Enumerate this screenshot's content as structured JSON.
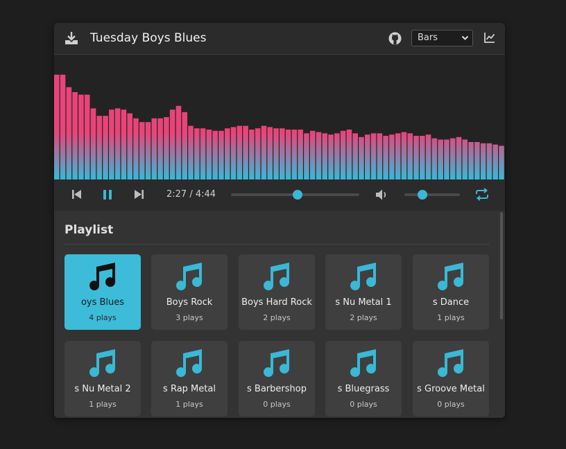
{
  "header": {
    "title": "Tuesday Boys Blues",
    "download_icon": "download-icon",
    "github_icon": "github-icon",
    "visualizer_select": "Bars",
    "chart_icon": "chart-icon"
  },
  "visualizer": {
    "gradient_top": "#e8447a",
    "gradient_bottom": "#3ab8d6",
    "bar_levels": [
      0.84,
      0.84,
      0.74,
      0.7,
      0.68,
      0.68,
      0.57,
      0.51,
      0.51,
      0.56,
      0.57,
      0.56,
      0.53,
      0.49,
      0.46,
      0.46,
      0.49,
      0.49,
      0.5,
      0.56,
      0.59,
      0.54,
      0.43,
      0.41,
      0.41,
      0.4,
      0.39,
      0.39,
      0.41,
      0.42,
      0.43,
      0.43,
      0.4,
      0.41,
      0.43,
      0.42,
      0.41,
      0.41,
      0.4,
      0.4,
      0.4,
      0.37,
      0.39,
      0.38,
      0.37,
      0.36,
      0.37,
      0.39,
      0.4,
      0.37,
      0.34,
      0.36,
      0.37,
      0.37,
      0.35,
      0.36,
      0.37,
      0.38,
      0.37,
      0.35,
      0.35,
      0.36,
      0.33,
      0.32,
      0.32,
      0.33,
      0.34,
      0.32,
      0.3,
      0.3,
      0.29,
      0.29,
      0.28,
      0.27
    ]
  },
  "controls": {
    "prev_icon": "skip-previous-icon",
    "pause_icon": "pause-icon",
    "next_icon": "skip-next-icon",
    "time": "2:27 / 4:44",
    "progress": 0.52,
    "volume_icon": "volume-icon",
    "volume": 0.33,
    "repeat_icon": "repeat-icon",
    "accent": "#3ab8d6"
  },
  "playlist": {
    "title": "Playlist",
    "items": [
      {
        "name": "oys Blues",
        "plays": "4 plays",
        "active": true
      },
      {
        "name": "Boys Rock",
        "plays": "3 plays",
        "active": false
      },
      {
        "name": "Boys Hard Rock",
        "plays": "2 plays",
        "active": false
      },
      {
        "name": "s Nu Metal 1",
        "plays": "2 plays",
        "active": false
      },
      {
        "name": "s Dance",
        "plays": "1 plays",
        "active": false
      },
      {
        "name": "s Nu Metal 2",
        "plays": "1 plays",
        "active": false
      },
      {
        "name": "s Rap Metal",
        "plays": "1 plays",
        "active": false
      },
      {
        "name": "s Barbershop",
        "plays": "0 plays",
        "active": false
      },
      {
        "name": "s Bluegrass",
        "plays": "0 plays",
        "active": false
      },
      {
        "name": "s Groove Metal",
        "plays": "0 plays",
        "active": false
      }
    ]
  }
}
